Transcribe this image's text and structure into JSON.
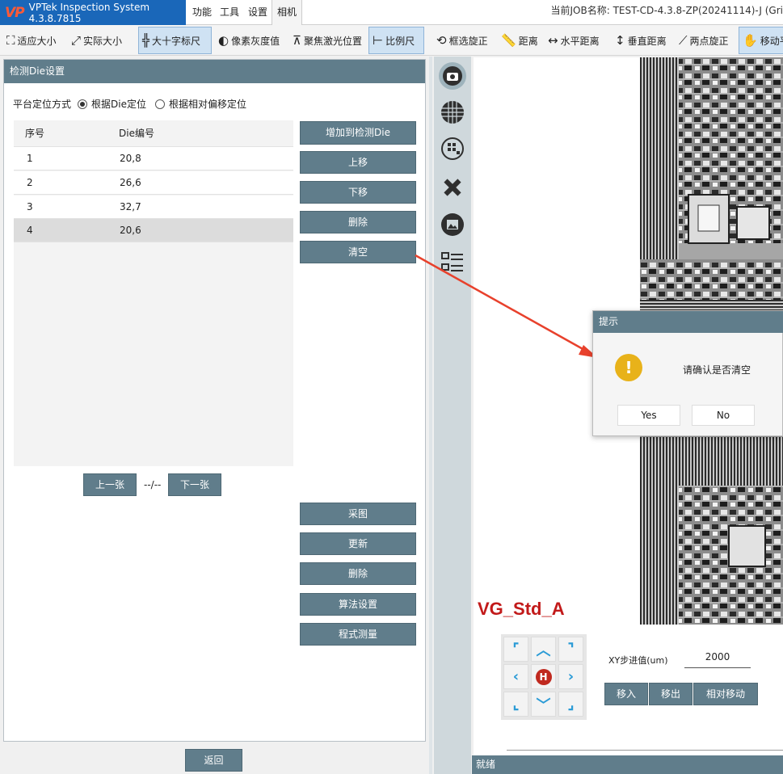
{
  "app": {
    "logo": "VP",
    "title": "VPTek Inspection System 4.3.8.7815",
    "menus": [
      "功能",
      "工具",
      "设置",
      "相机"
    ],
    "job_info": "当前JOB名称:  TEST-CD-4.3.8-ZP(20241114)-J (Gri"
  },
  "toolbar": {
    "fit": "适应大小",
    "actual": "实际大小",
    "crosshair": "大十字标尺",
    "gray": "像素灰度值",
    "focus": "聚焦激光位置",
    "scale": "比例尺",
    "rotate_box": "框选旋正",
    "distance": "距离",
    "hdistance": "水平距离",
    "vdistance": "垂直距离",
    "two_point": "两点旋正",
    "move": "移动平"
  },
  "panel": {
    "title": "检测Die设置",
    "mode_label": "平台定位方式",
    "mode_die": "根据Die定位",
    "mode_offset": "根据相对偏移定位",
    "col_index": "序号",
    "col_die": "Die编号",
    "rows": [
      {
        "idx": "1",
        "die": "20,8"
      },
      {
        "idx": "2",
        "die": "26,6"
      },
      {
        "idx": "3",
        "die": "32,7"
      },
      {
        "idx": "4",
        "die": "20,6"
      }
    ],
    "btn_add": "增加到检测Die",
    "btn_up": "上移",
    "btn_down": "下移",
    "btn_delete": "删除",
    "btn_clear": "清空",
    "prev": "上一张",
    "page": "--/--",
    "next": "下一张",
    "btn_capture": "采图",
    "btn_update": "更新",
    "btn_delete2": "删除",
    "btn_algo": "算法设置",
    "btn_measure": "程式测量",
    "btn_back": "返回"
  },
  "viewer": {
    "label": "VG_Std_A"
  },
  "dialog": {
    "title": "提示",
    "message": "请确认是否清空",
    "yes": "Yes",
    "no": "No",
    "icon": "warning-icon",
    "icon_color": "#e8b21a"
  },
  "controls": {
    "step_label": "XY步进值(um)",
    "step_value": "2000",
    "move_in": "移入",
    "move_out": "移出",
    "relative": "相对移动",
    "home": "H"
  },
  "status": {
    "text": "就绪"
  },
  "colors": {
    "accent": "#607d8b",
    "brand": "#1a67b9",
    "arrow": "#e8412c"
  }
}
